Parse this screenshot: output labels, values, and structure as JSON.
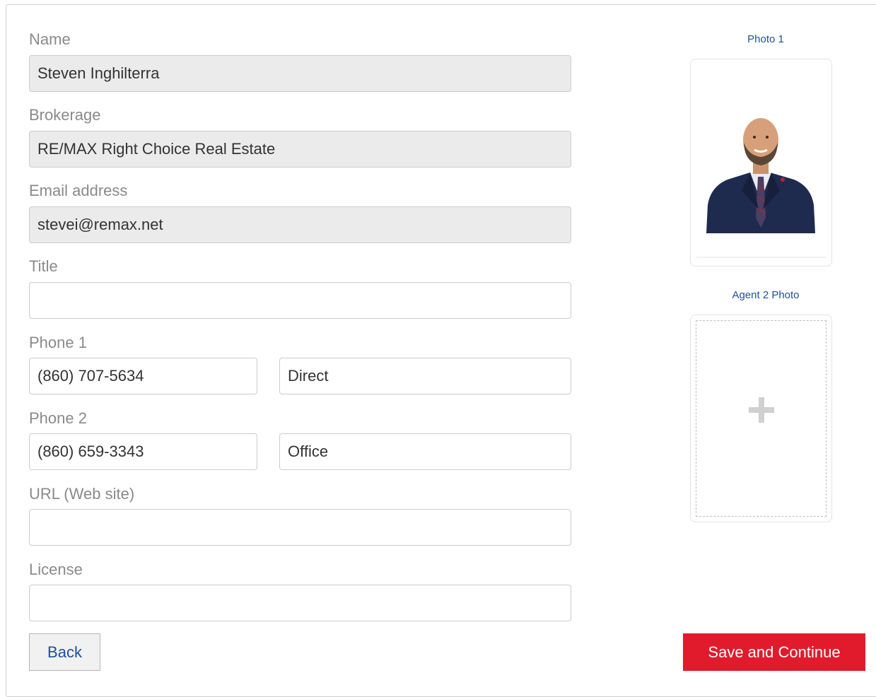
{
  "form": {
    "name_label": "Name",
    "name_value": "Steven Inghilterra",
    "brokerage_label": "Brokerage",
    "brokerage_value": "RE/MAX Right Choice Real Estate",
    "email_label": "Email address",
    "email_value": "stevei@remax.net",
    "title_label": "Title",
    "title_value": "",
    "phone1_label": "Phone 1",
    "phone1_number": "(860) 707-5634",
    "phone1_type": "Direct",
    "phone2_label": "Phone 2",
    "phone2_number": "(860) 659-3343",
    "phone2_type": "Office",
    "url_label": "URL (Web site)",
    "url_value": "",
    "license_label": "License",
    "license_value": ""
  },
  "photos": {
    "photo1_label": "Photo 1",
    "photo1_icon": "agent-headshot",
    "photo2_label": "Agent 2 Photo",
    "photo2_icon": "plus-icon"
  },
  "actions": {
    "back_label": "Back",
    "save_label": "Save and Continue"
  },
  "colors": {
    "accent_red": "#e11b2c",
    "link_blue": "#1f4f9c",
    "readonly_bg": "#ebebeb"
  }
}
